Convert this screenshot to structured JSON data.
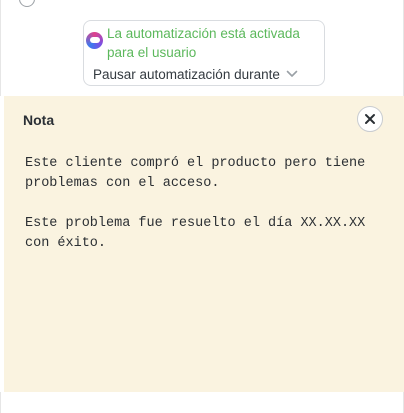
{
  "automation": {
    "status_text": "La automatización está activada para el usuario",
    "pause_label": "Pausar automatización durante"
  },
  "note": {
    "title": "Nota",
    "paragraphs": [
      "Este cliente compró el producto pero tiene problemas con el acceso.",
      "Este problema fue resuelto el día XX.XX.XX con éxito."
    ]
  },
  "colors": {
    "status_green": "#5cb85c",
    "note_background": "#faf3e0"
  },
  "icons": {
    "bot": "bot-icon",
    "dropdown": "chevron-down-icon",
    "close": "close-icon"
  }
}
